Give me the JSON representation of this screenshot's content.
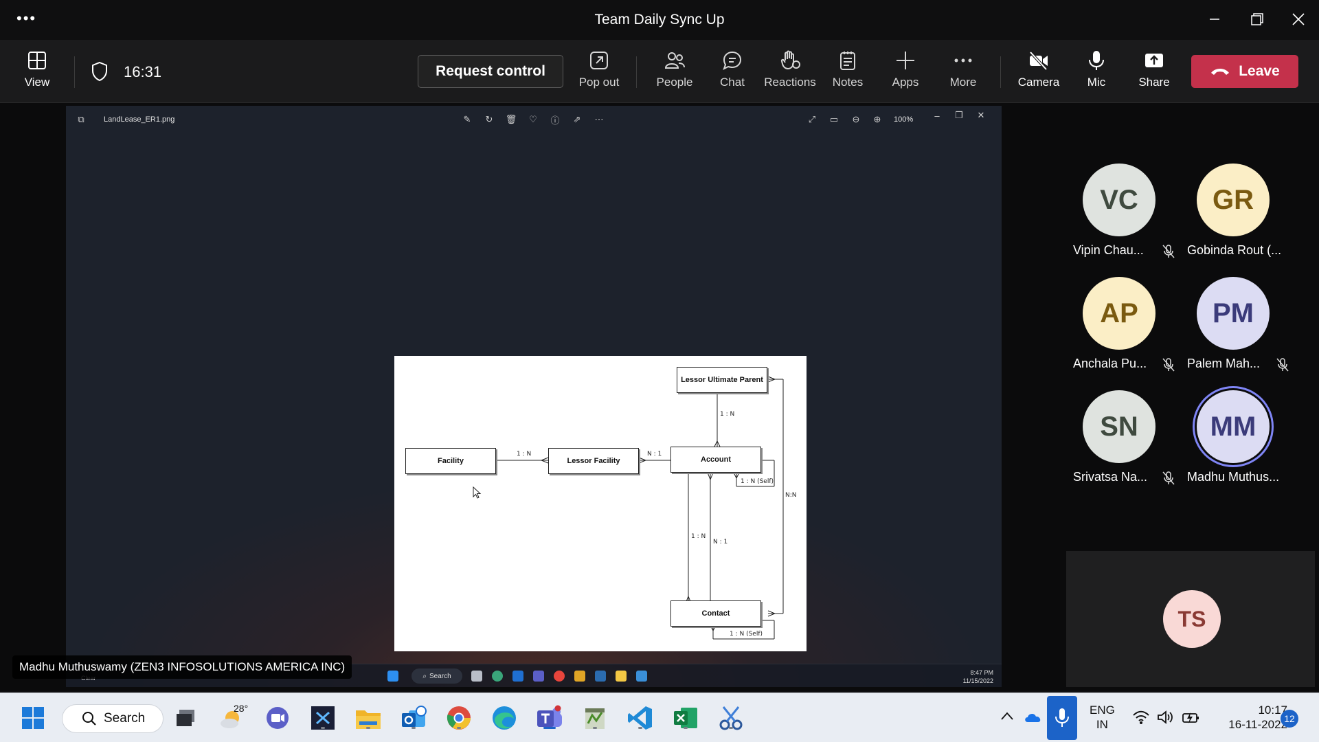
{
  "window": {
    "title": "Team Daily Sync Up",
    "more_dots": "•••"
  },
  "toolbar": {
    "view_label": "View",
    "timer": "16:31",
    "request_control": "Request control",
    "popout_label": "Pop out",
    "people_label": "People",
    "chat_label": "Chat",
    "reactions_label": "Reactions",
    "notes_label": "Notes",
    "apps_label": "Apps",
    "more_label": "More",
    "camera_label": "Camera",
    "mic_label": "Mic",
    "share_label": "Share",
    "leave_label": "Leave",
    "leave_color": "#c4314b"
  },
  "viewer": {
    "filename": "LandLease_ER1.png",
    "zoom": "100%"
  },
  "diagram": {
    "entities": {
      "lessor_parent": "Lessor Ultimate Parent",
      "facility": "Facility",
      "lessor_facility": "Lessor Facility",
      "account": "Account",
      "contact": "Contact"
    },
    "relations": {
      "parent_account": "1 : N",
      "facility_lf": "1 : N",
      "lf_account": "N : 1",
      "account_self": "1 : N (Self)",
      "account_contact_left": "1 : N",
      "account_contact_right": "N : 1",
      "nn": "N:N",
      "contact_self": "1 : N (Self)"
    }
  },
  "inner_taskbar": {
    "search": "Search",
    "time": "8:47 PM",
    "date": "11/15/2022",
    "weather": "Clear"
  },
  "presenter": "Madhu Muthuswamy (ZEN3 INFOSOLUTIONS AMERICA INC)",
  "participants": [
    {
      "initials": "VC",
      "name": "Vipin Chau...",
      "bg": "#dfe3df",
      "fg": "#3f4a3f"
    },
    {
      "initials": "GR",
      "name": "Gobinda Rout (...",
      "bg": "#fbeec6",
      "fg": "#7a5a10"
    },
    {
      "initials": "AP",
      "name": "Anchala Pu...",
      "bg": "#fbeec6",
      "fg": "#7a5a10"
    },
    {
      "initials": "PM",
      "name": "Palem Mah...",
      "bg": "#dcdcf3",
      "fg": "#3b3b7a"
    },
    {
      "initials": "SN",
      "name": "Srivatsa Na...",
      "bg": "#dfe3df",
      "fg": "#3f4a3f"
    },
    {
      "initials": "MM",
      "name": "Madhu Muthus...",
      "bg": "#dcdcf3",
      "fg": "#3b3b7a"
    }
  ],
  "self": {
    "initials": "TS"
  },
  "taskbar": {
    "search": "Search",
    "weather_temp": "28°",
    "lang_top": "ENG",
    "lang_bottom": "IN",
    "time": "10:17",
    "date": "16-11-2022",
    "notifications": "12"
  }
}
